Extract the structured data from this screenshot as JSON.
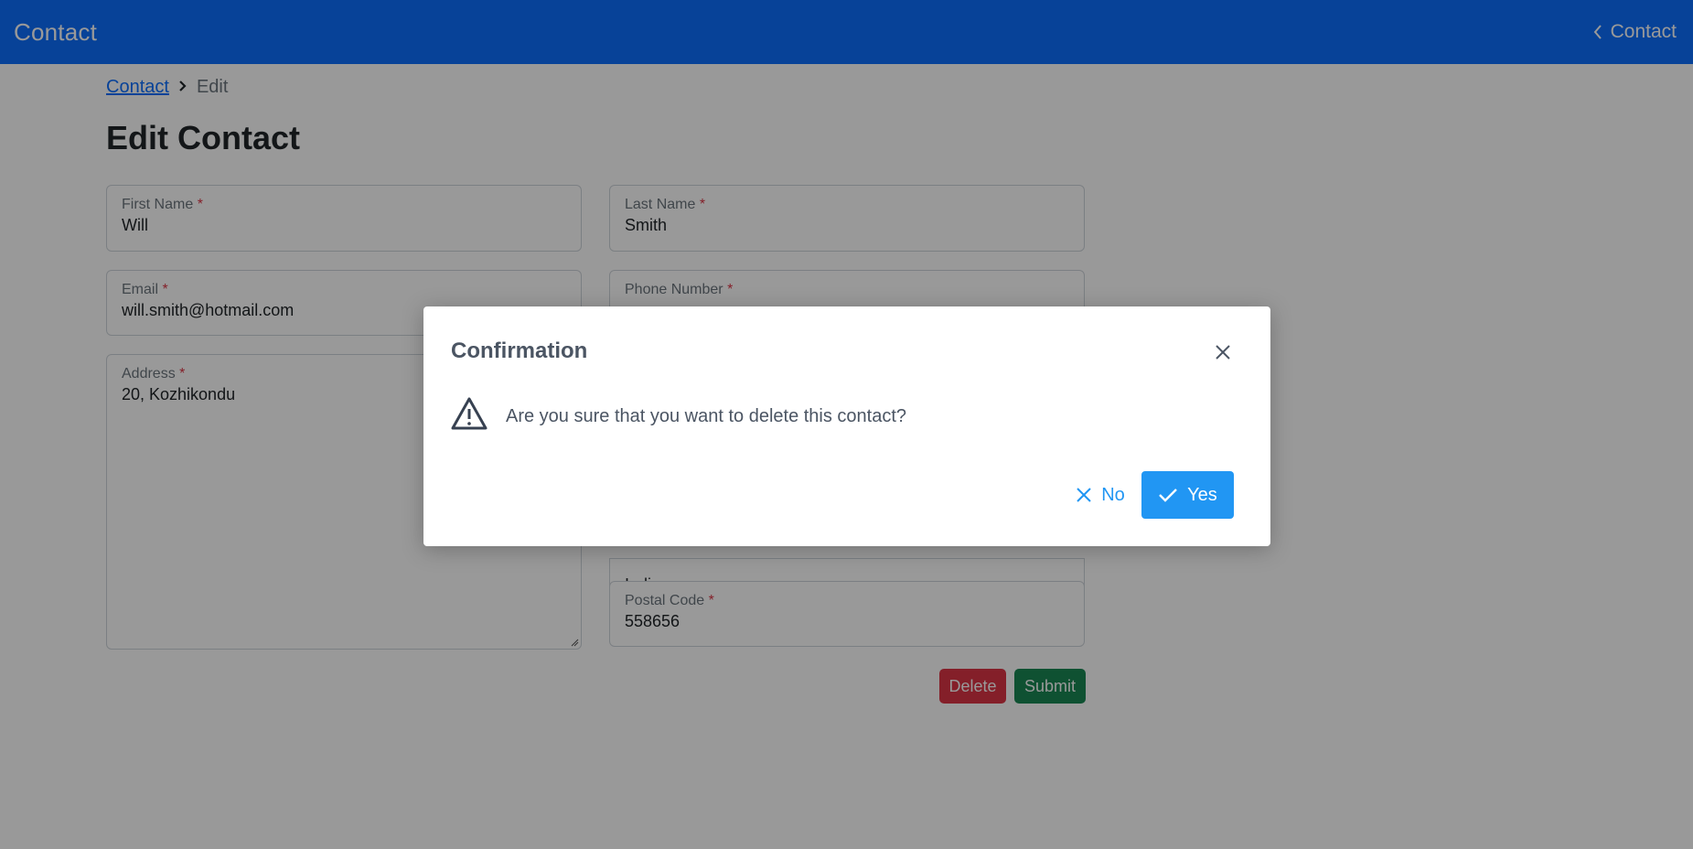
{
  "navbar": {
    "brand": "Contact",
    "back_label": "Contact"
  },
  "breadcrumb": {
    "link": "Contact",
    "current": "Edit"
  },
  "page_title": "Edit Contact",
  "form": {
    "required_mark": "*",
    "first_name": {
      "label": "First Name",
      "value": "Will"
    },
    "last_name": {
      "label": "Last Name",
      "value": "Smith"
    },
    "email": {
      "label": "Email",
      "value": "will.smith@hotmail.com"
    },
    "phone": {
      "label": "Phone Number",
      "value": ""
    },
    "address": {
      "label": "Address",
      "value": "20, Kozhikondu"
    },
    "country": {
      "value": "India"
    },
    "postal_code": {
      "label": "Postal Code",
      "value": "558656"
    },
    "delete_label": "Delete",
    "submit_label": "Submit"
  },
  "dialog": {
    "title": "Confirmation",
    "message": "Are you sure that you want to delete this contact?",
    "no_label": "No",
    "yes_label": "Yes"
  },
  "colors": {
    "primary": "#0d6efd",
    "danger": "#dc3545",
    "success": "#198754",
    "dialog_accent": "#2196f3"
  }
}
